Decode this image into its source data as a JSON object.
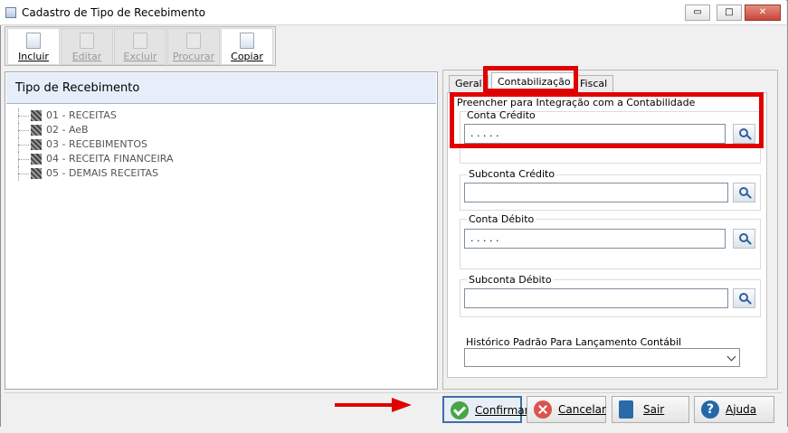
{
  "window": {
    "title": "Cadastro de Tipo de Recebimento",
    "minimize_label": "▭",
    "maximize_label": "□",
    "close_label": "✕"
  },
  "toolbar": {
    "buttons": [
      {
        "label": "Incluir",
        "state": "active",
        "icon": "new-document-icon"
      },
      {
        "label": "Editar",
        "state": "disabled",
        "icon": "edit-document-icon"
      },
      {
        "label": "Excluir",
        "state": "disabled",
        "icon": "delete-document-icon"
      },
      {
        "label": "Procurar",
        "state": "disabled",
        "icon": "search-document-icon"
      },
      {
        "label": "Copiar",
        "state": "active",
        "icon": "copy-document-icon"
      }
    ]
  },
  "tree": {
    "title": "Tipo de Recebimento",
    "items": [
      {
        "label": "01 - RECEITAS"
      },
      {
        "label": "02 - AeB"
      },
      {
        "label": "03 - RECEBIMENTOS"
      },
      {
        "label": "04 - RECEITA FINANCEIRA"
      },
      {
        "label": "05 - DEMAIS RECEITAS"
      }
    ]
  },
  "tabs": [
    {
      "label": "Geral"
    },
    {
      "label": "Contabilização"
    },
    {
      "label": "Fiscal"
    }
  ],
  "form": {
    "section_title": "Preencher para Integração com a Contabilidade",
    "conta_credito": {
      "label": "Conta Crédito",
      "value": ". . . . ."
    },
    "subconta_credito": {
      "label": "Subconta Crédito",
      "value": ""
    },
    "conta_debito": {
      "label": "Conta Débito",
      "value": ". . . . ."
    },
    "subconta_debito": {
      "label": "Subconta Débito",
      "value": ""
    },
    "historico": {
      "label": "Histórico Padrão Para Lançamento Contábil",
      "value": ""
    }
  },
  "actions": {
    "confirm": "Confirmar",
    "cancel": "Cancelar",
    "exit": "Sair",
    "help": "Ajuda"
  },
  "colors": {
    "highlight": "#e00000",
    "primary_border": "#3d6ea7"
  }
}
